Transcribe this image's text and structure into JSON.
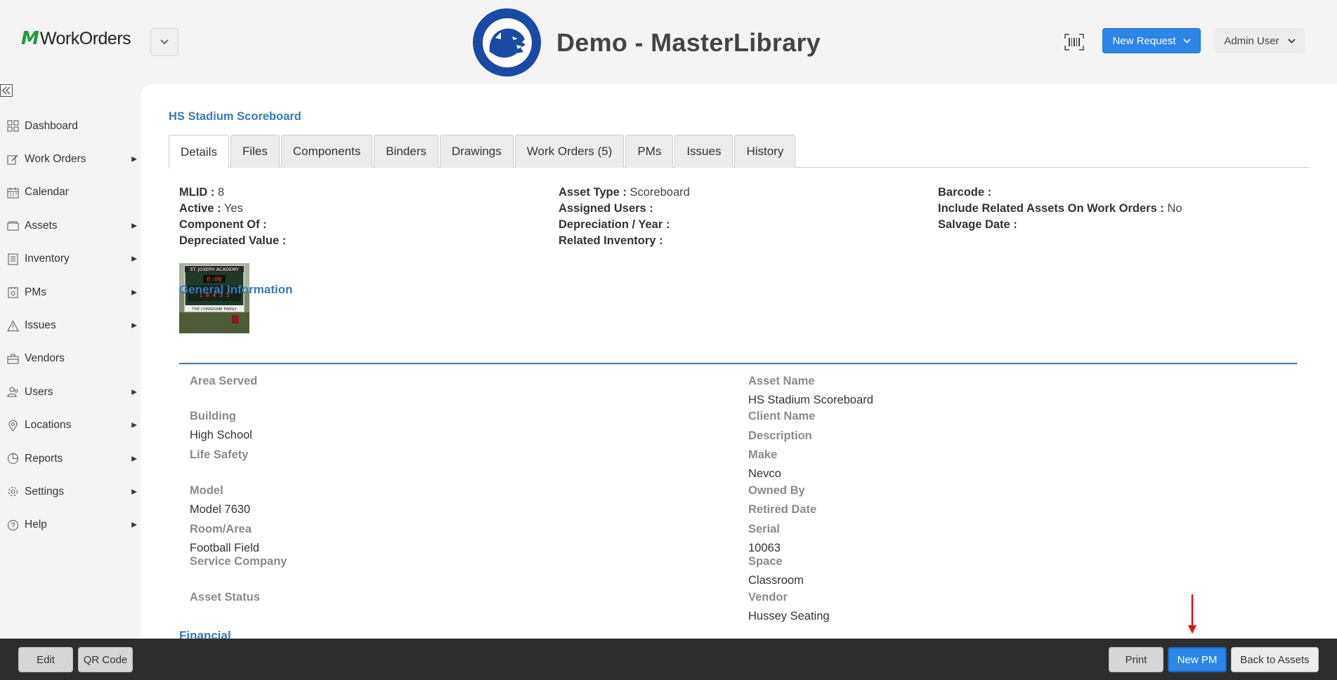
{
  "header": {
    "logo_mark": "M",
    "logo_text": "WorkOrders",
    "title": "Demo - MasterLibrary",
    "new_request_label": "New Request",
    "user_label": "Admin User"
  },
  "sidebar": {
    "items": [
      {
        "label": "Dashboard",
        "icon": "dashboard-icon",
        "has_submenu": false
      },
      {
        "label": "Work Orders",
        "icon": "work-orders-icon",
        "has_submenu": true
      },
      {
        "label": "Calendar",
        "icon": "calendar-icon",
        "has_submenu": false
      },
      {
        "label": "Assets",
        "icon": "assets-icon",
        "has_submenu": true
      },
      {
        "label": "Inventory",
        "icon": "inventory-icon",
        "has_submenu": true
      },
      {
        "label": "PMs",
        "icon": "pms-icon",
        "has_submenu": true
      },
      {
        "label": "Issues",
        "icon": "warning-icon",
        "has_submenu": true
      },
      {
        "label": "Vendors",
        "icon": "briefcase-icon",
        "has_submenu": false
      },
      {
        "label": "Users",
        "icon": "users-icon",
        "has_submenu": true
      },
      {
        "label": "Locations",
        "icon": "location-pin-icon",
        "has_submenu": true
      },
      {
        "label": "Reports",
        "icon": "pie-chart-icon",
        "has_submenu": true
      },
      {
        "label": "Settings",
        "icon": "gear-icon",
        "has_submenu": true
      },
      {
        "label": "Help",
        "icon": "help-icon",
        "has_submenu": true
      }
    ]
  },
  "main": {
    "breadcrumb": "HS Stadium Scoreboard",
    "tabs": [
      {
        "label": "Details",
        "active": true
      },
      {
        "label": "Files",
        "active": false
      },
      {
        "label": "Components",
        "active": false
      },
      {
        "label": "Binders",
        "active": false
      },
      {
        "label": "Drawings",
        "active": false
      },
      {
        "label": "Work Orders (5)",
        "active": false
      },
      {
        "label": "PMs",
        "active": false
      },
      {
        "label": "Issues",
        "active": false
      },
      {
        "label": "History",
        "active": false
      }
    ],
    "meta": {
      "col1": [
        {
          "label": "MLID :",
          "value": "8"
        },
        {
          "label": "Active :",
          "value": "Yes"
        },
        {
          "label": "Component Of :",
          "value": ""
        },
        {
          "label": "Depreciated Value :",
          "value": ""
        }
      ],
      "col2": [
        {
          "label": "Asset Type :",
          "value": "Scoreboard"
        },
        {
          "label": "Assigned Users :",
          "value": ""
        },
        {
          "label": "Depreciation / Year :",
          "value": ""
        },
        {
          "label": "Related Inventory :",
          "value": ""
        }
      ],
      "col3": [
        {
          "label": "Barcode :",
          "value": ""
        },
        {
          "label": "Include Related Assets On Work Orders :",
          "value": "No"
        },
        {
          "label": "Salvage Date :",
          "value": ""
        }
      ]
    },
    "image_caption": {
      "top": "ST. JOSEPH ACADEMY",
      "bottom": "THE CONSIDINE FAMILY"
    },
    "general_title": "General Information",
    "left_fields": [
      {
        "label": "Area Served",
        "value": ""
      },
      {
        "label": "Building",
        "value": "High School"
      },
      {
        "label": "Life Safety",
        "value": ""
      },
      {
        "label": "Model",
        "value": "Model 7630"
      },
      {
        "label": "Room/Area",
        "value": "Football Field"
      },
      {
        "label": "Service Company",
        "value": ""
      },
      {
        "label": "Asset Status",
        "value": ""
      }
    ],
    "right_fields": [
      {
        "label": "Asset Name",
        "value": "HS Stadium Scoreboard"
      },
      {
        "label": "Client Name",
        "value": ""
      },
      {
        "label": "Description",
        "value": ""
      },
      {
        "label": "Make",
        "value": "Nevco"
      },
      {
        "label": "Owned By",
        "value": ""
      },
      {
        "label": "Retired Date",
        "value": ""
      },
      {
        "label": "Serial",
        "value": "10063"
      },
      {
        "label": "Space",
        "value": "Classroom"
      },
      {
        "label": "Vendor",
        "value": "Hussey Seating"
      }
    ],
    "financial_title": "Financial"
  },
  "footer": {
    "edit_label": "Edit",
    "qr_label": "QR Code",
    "print_label": "Print",
    "new_pm_label": "New PM",
    "back_label": "Back to Assets"
  },
  "colors": {
    "accent": "#2b86e8",
    "brand_green": "#1f9a3a",
    "link_blue": "#3d78b8",
    "annotation_red": "#e01010"
  }
}
